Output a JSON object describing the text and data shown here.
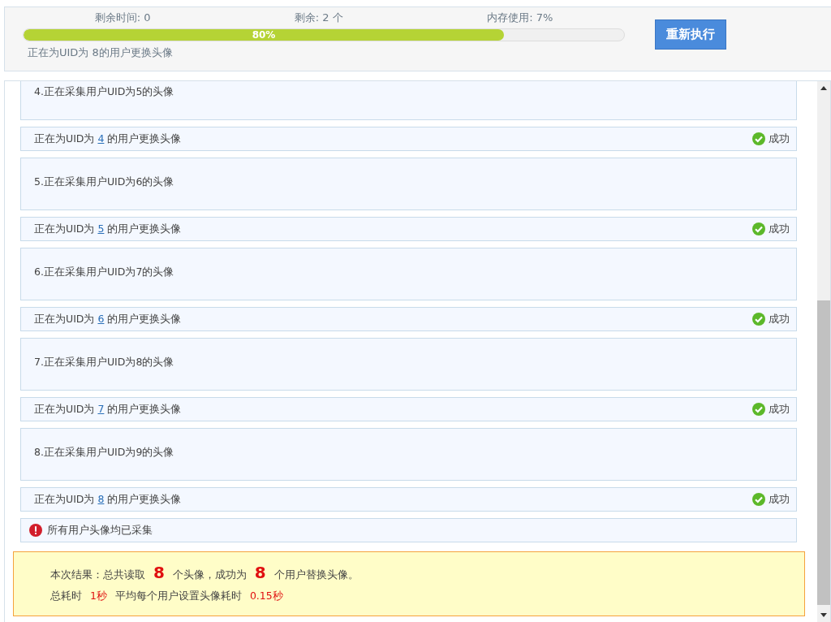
{
  "progress": {
    "time_left": "剩余时间: 0",
    "remaining": "剩余: 2 个",
    "memory": "内存使用: 7%",
    "level": 0.8,
    "percent": "80%",
    "status": "正在为UID为 8的用户更换头像"
  },
  "rerun_button": "重新执行",
  "log": [
    {
      "kind": "collect",
      "text": "4.正在采集用户UID为5的头像"
    },
    {
      "kind": "replace",
      "prefix": "正在为UID为",
      "uid": "4",
      "suffix": "的用户更换头像",
      "status": "成功"
    },
    {
      "kind": "collect",
      "text": "5.正在采集用户UID为6的头像"
    },
    {
      "kind": "replace",
      "prefix": "正在为UID为",
      "uid": "5",
      "suffix": "的用户更换头像",
      "status": "成功"
    },
    {
      "kind": "collect",
      "text": "6.正在采集用户UID为7的头像"
    },
    {
      "kind": "replace",
      "prefix": "正在为UID为",
      "uid": "6",
      "suffix": "的用户更换头像",
      "status": "成功"
    },
    {
      "kind": "collect",
      "text": "7.正在采集用户UID为8的头像"
    },
    {
      "kind": "replace",
      "prefix": "正在为UID为",
      "uid": "7",
      "suffix": "的用户更换头像",
      "status": "成功"
    },
    {
      "kind": "collect",
      "text": "8.正在采集用户UID为9的头像"
    },
    {
      "kind": "replace",
      "prefix": "正在为UID为",
      "uid": "8",
      "suffix": "的用户更换头像",
      "status": "成功"
    },
    {
      "kind": "warning",
      "text": "所有用户头像均已采集"
    }
  ],
  "summary": [
    {
      "kind": "count",
      "text": "本次结果：总共读取 **8** 个头像，成功为 **8** 个用户替换头像。"
    },
    {
      "kind": "time",
      "text": "总耗时  **1秒**  平均每个用户设置头像耗时 **0.15秒**"
    }
  ]
}
